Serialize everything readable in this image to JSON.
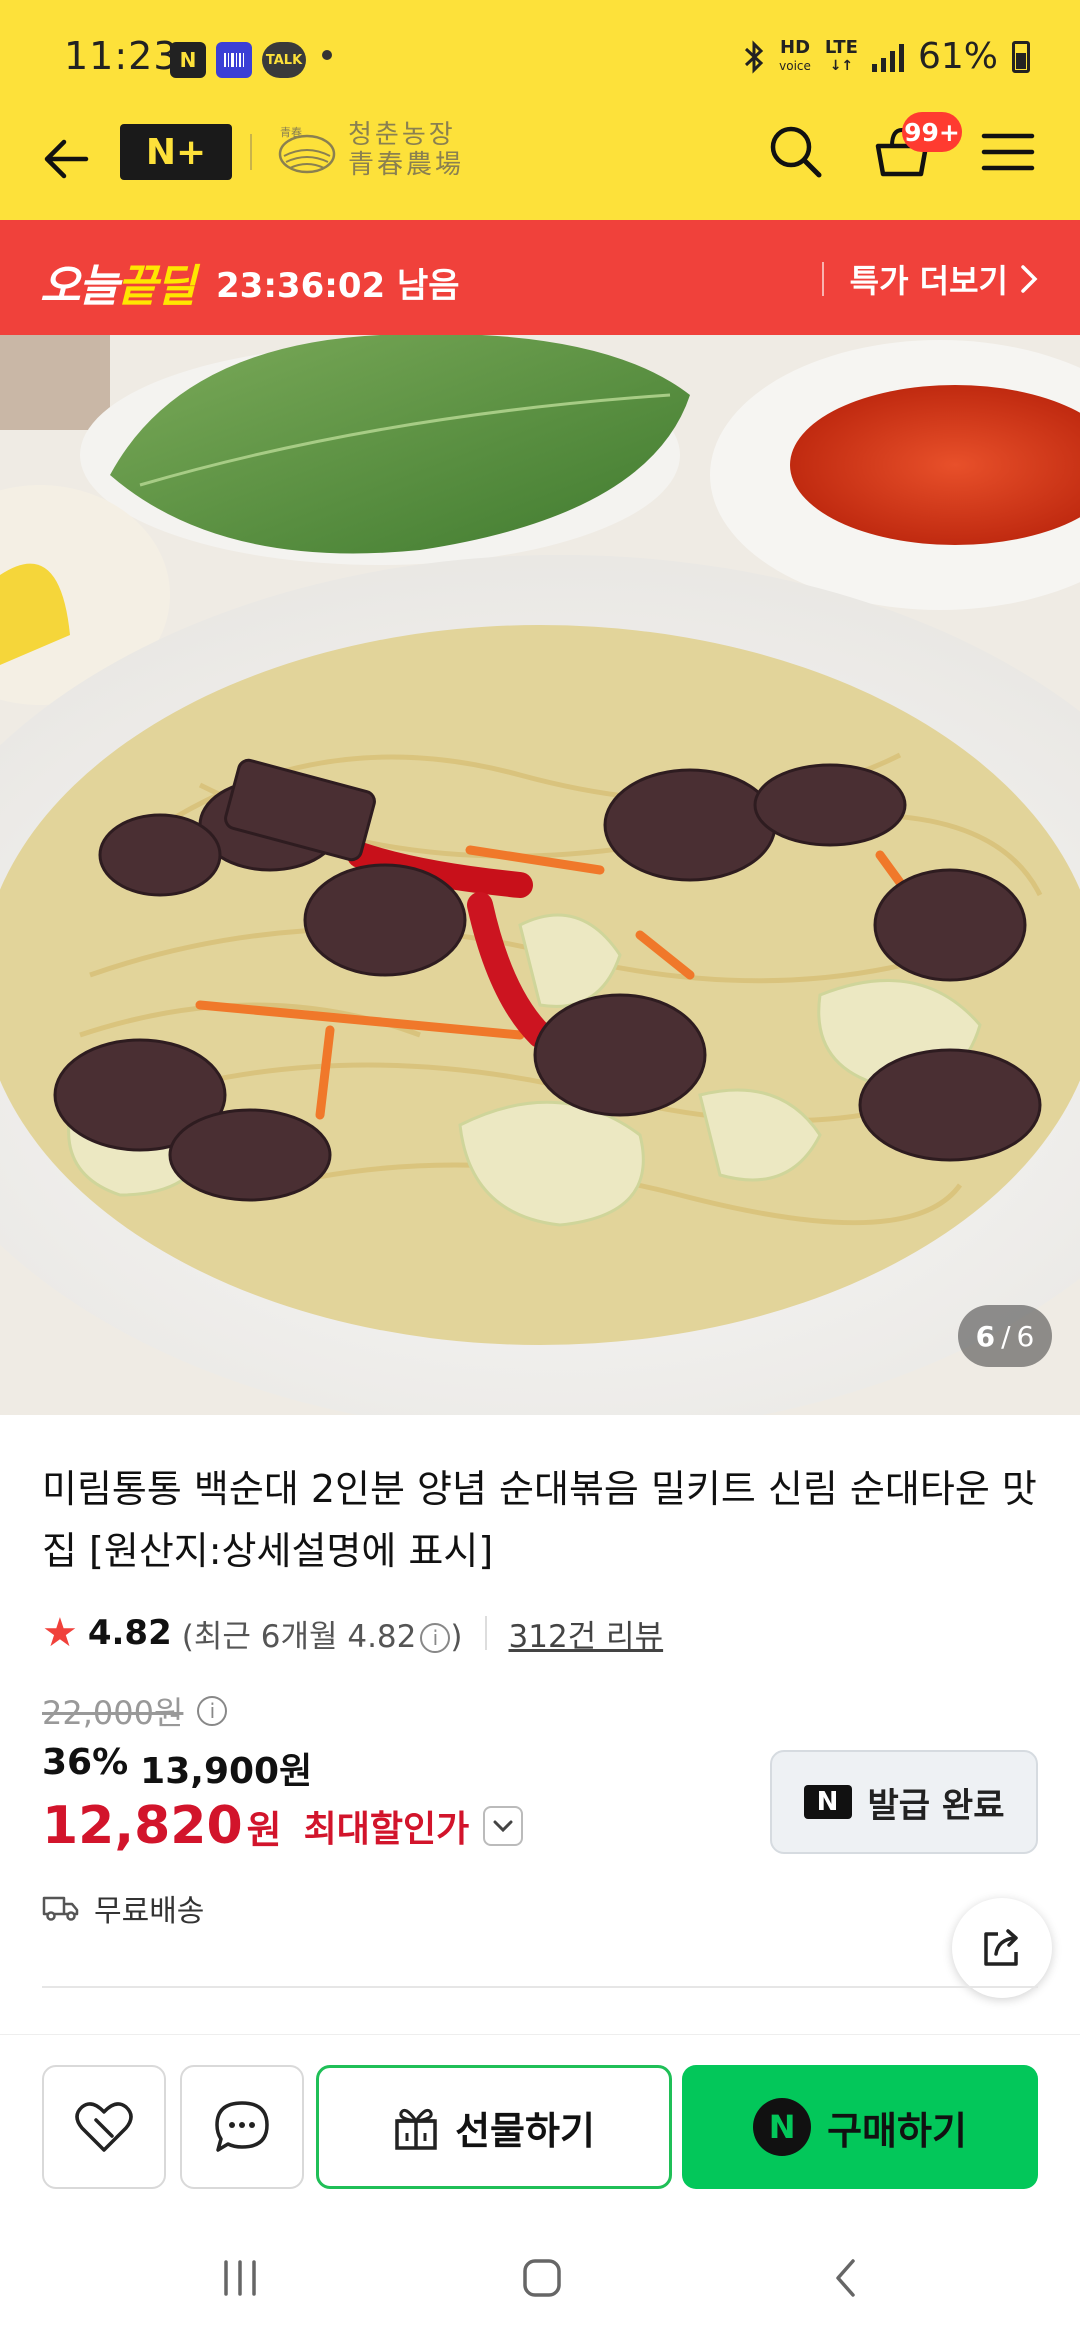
{
  "status_bar": {
    "time": "11:23",
    "notif_n": "N",
    "notif_talk": "TALK",
    "hd_voice": "HD",
    "hd_voice_sub": "voice",
    "lte": "LTE",
    "battery": "61%"
  },
  "header": {
    "store_brand": "N+",
    "farm_name_kr": "청춘농장",
    "farm_name_cn": "青春農場",
    "cart_count": "99+"
  },
  "deal_banner": {
    "logo_a": "오늘",
    "logo_b": "끝딜",
    "timer": "23:36:02 남음",
    "more_label": "특가 더보기"
  },
  "gallery": {
    "current": "6",
    "separator": "/",
    "total": "6"
  },
  "product": {
    "title": "미림통통 백순대 2인분 양념 순대볶음 밀키트 신림 순대타운 맛집 [원산지:상세설명에 표시]",
    "rating": "4.82",
    "recent_rating_label": "(최근 6개월 4.82",
    "recent_rating_close": ")",
    "review_count": "312건 리뷰",
    "original_price": "22,000원",
    "discount_rate": "36%",
    "discount_price": "13,900원",
    "final_price": "12,820",
    "final_unit": "원",
    "max_discount_label": "최대할인가",
    "coupon_label": "발급 완료",
    "coupon_badge": "N",
    "shipping": "무료배송"
  },
  "actions": {
    "gift_label": "선물하기",
    "buy_label": "구매하기",
    "npay_badge": "N"
  },
  "colors": {
    "header_yellow": "#fde13a",
    "deal_red": "#f0413b",
    "price_red": "#d2142b",
    "buy_green": "#03c75a"
  },
  "icons": [
    "back-arrow-icon",
    "search-icon",
    "cart-icon",
    "menu-icon",
    "info-icon",
    "truck-icon",
    "share-icon",
    "heart-icon",
    "chat-icon",
    "gift-icon"
  ]
}
